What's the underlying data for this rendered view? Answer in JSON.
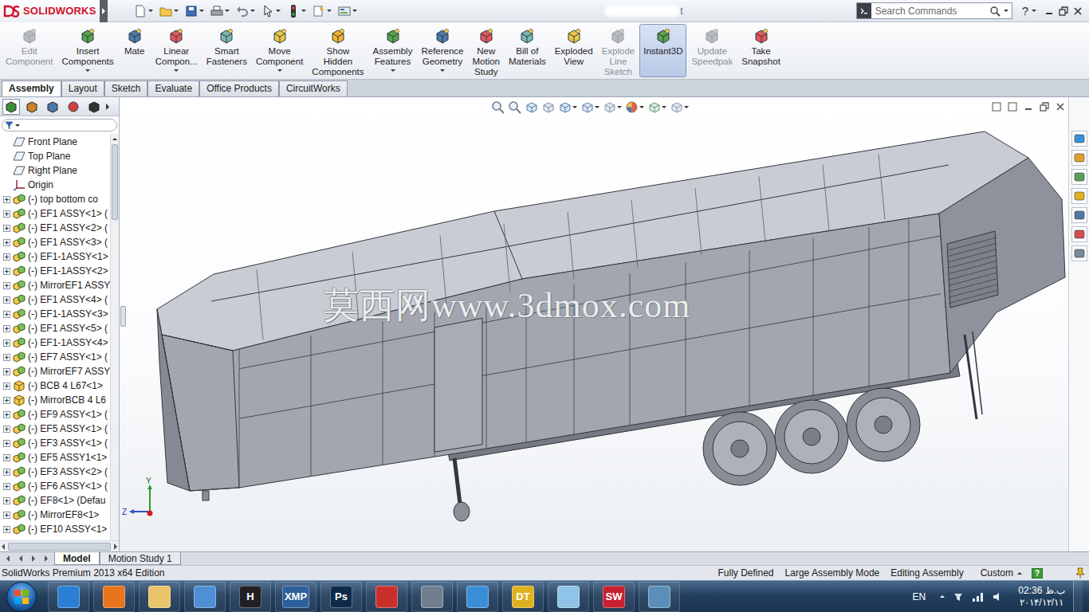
{
  "window": {
    "app": "SOLIDWORKS",
    "title": "t",
    "search": {
      "placeholder": "Search Commands"
    },
    "help": "?"
  },
  "ribbon": {
    "buttons": [
      {
        "lines": [
          "Edit",
          "Component"
        ],
        "disabled": true,
        "dropdown": false,
        "selected": false
      },
      {
        "lines": [
          "Insert",
          "Components"
        ],
        "disabled": false,
        "dropdown": true,
        "selected": false
      },
      {
        "lines": [
          "Mate"
        ],
        "disabled": false,
        "dropdown": false,
        "selected": false
      },
      {
        "lines": [
          "Linear",
          "Compon..."
        ],
        "disabled": false,
        "dropdown": true,
        "selected": false
      },
      {
        "lines": [
          "Smart",
          "Fasteners"
        ],
        "disabled": false,
        "dropdown": false,
        "selected": false
      },
      {
        "lines": [
          "Move",
          "Component"
        ],
        "disabled": false,
        "dropdown": true,
        "selected": false
      },
      {
        "lines": [
          "Show",
          "Hidden",
          "Components"
        ],
        "disabled": false,
        "dropdown": false,
        "selected": false
      },
      {
        "lines": [
          "Assembly",
          "Features"
        ],
        "disabled": false,
        "dropdown": true,
        "selected": false
      },
      {
        "lines": [
          "Reference",
          "Geometry"
        ],
        "disabled": false,
        "dropdown": true,
        "selected": false
      },
      {
        "lines": [
          "New",
          "Motion",
          "Study"
        ],
        "disabled": false,
        "dropdown": false,
        "selected": false
      },
      {
        "lines": [
          "Bill of",
          "Materials"
        ],
        "disabled": false,
        "dropdown": false,
        "selected": false
      },
      {
        "lines": [
          "Exploded",
          "View"
        ],
        "disabled": false,
        "dropdown": false,
        "selected": false
      },
      {
        "lines": [
          "Explode",
          "Line",
          "Sketch"
        ],
        "disabled": true,
        "dropdown": false,
        "selected": false
      },
      {
        "lines": [
          "Instant3D"
        ],
        "disabled": false,
        "dropdown": false,
        "selected": true
      },
      {
        "lines": [
          "Update",
          "Speedpak"
        ],
        "disabled": true,
        "dropdown": false,
        "selected": false
      },
      {
        "lines": [
          "Take",
          "Snapshot"
        ],
        "disabled": false,
        "dropdown": false,
        "selected": false
      }
    ]
  },
  "tabs": [
    {
      "label": "Assembly",
      "selected": true
    },
    {
      "label": "Layout",
      "selected": false
    },
    {
      "label": "Sketch",
      "selected": false
    },
    {
      "label": "Evaluate",
      "selected": false
    },
    {
      "label": "Office Products",
      "selected": false
    },
    {
      "label": "CircuitWorks",
      "selected": false
    }
  ],
  "tree": {
    "items": [
      {
        "label": "Front Plane",
        "kind": "plane",
        "expandable": false
      },
      {
        "label": "Top Plane",
        "kind": "plane",
        "expandable": false
      },
      {
        "label": "Right Plane",
        "kind": "plane",
        "expandable": false
      },
      {
        "label": "Origin",
        "kind": "origin",
        "expandable": false
      },
      {
        "label": "(-) top bottom co",
        "kind": "assembly",
        "expandable": true
      },
      {
        "label": "(-) EF1 ASSY<1> (",
        "kind": "assembly",
        "expandable": true
      },
      {
        "label": "(-) EF1 ASSY<2> (",
        "kind": "assembly",
        "expandable": true
      },
      {
        "label": "(-) EF1 ASSY<3> (",
        "kind": "assembly",
        "expandable": true
      },
      {
        "label": "(-) EF1-1ASSY<1>",
        "kind": "assembly",
        "expandable": true
      },
      {
        "label": "(-) EF1-1ASSY<2>",
        "kind": "assembly",
        "expandable": true
      },
      {
        "label": "(-) MirrorEF1 ASSY",
        "kind": "assembly",
        "expandable": true
      },
      {
        "label": "(-) EF1 ASSY<4> (",
        "kind": "assembly",
        "expandable": true
      },
      {
        "label": "(-) EF1-1ASSY<3>",
        "kind": "assembly",
        "expandable": true
      },
      {
        "label": "(-) EF1 ASSY<5> (",
        "kind": "assembly",
        "expandable": true
      },
      {
        "label": "(-) EF1-1ASSY<4>",
        "kind": "assembly",
        "expandable": true
      },
      {
        "label": "(-) EF7 ASSY<1> (",
        "kind": "assembly",
        "expandable": true
      },
      {
        "label": "(-) MirrorEF7 ASSY",
        "kind": "assembly",
        "expandable": true
      },
      {
        "label": "(-) BCB 4 L67<1>",
        "kind": "part",
        "expandable": true
      },
      {
        "label": "(-) MirrorBCB 4 L6",
        "kind": "part",
        "expandable": true
      },
      {
        "label": "(-) EF9 ASSY<1> (",
        "kind": "assembly",
        "expandable": true
      },
      {
        "label": "(-) EF5 ASSY<1> (",
        "kind": "assembly",
        "expandable": true
      },
      {
        "label": "(-) EF3 ASSY<1> (",
        "kind": "assembly",
        "expandable": true
      },
      {
        "label": "(-) EF5 ASSY1<1>",
        "kind": "assembly",
        "expandable": true
      },
      {
        "label": "(-) EF3 ASSY<2> (",
        "kind": "assembly",
        "expandable": true
      },
      {
        "label": "(-) EF6 ASSY<1> (",
        "kind": "assembly",
        "expandable": true
      },
      {
        "label": "(-) EF8<1> (Defau",
        "kind": "assembly",
        "expandable": true
      },
      {
        "label": "(-) MirrorEF8<1>",
        "kind": "assembly",
        "expandable": true
      },
      {
        "label": "(-) EF10 ASSY<1>",
        "kind": "assembly",
        "expandable": true
      }
    ]
  },
  "canvas": {
    "watermark": "莫西网www.3dmox.com",
    "triad": {
      "y": "Y",
      "z": "Z"
    }
  },
  "bottom_tabs": [
    {
      "label": "Model",
      "selected": true
    },
    {
      "label": "Motion Study 1",
      "selected": false
    }
  ],
  "status_bar": {
    "edition": "SolidWorks Premium 2013 x64 Edition",
    "items": [
      "Fully Defined",
      "Large Assembly Mode",
      "Editing Assembly"
    ],
    "units": "Custom",
    "help": "?"
  },
  "taskbar": {
    "apps": [
      {
        "color": "#2a7fd4"
      },
      {
        "color": "#e8741c"
      },
      {
        "color": "#e9c46a"
      },
      {
        "color": "#4f8fd6"
      },
      {
        "label": "H",
        "color": "#1f1f24"
      },
      {
        "label": "XMP",
        "color": "#2d5f9a"
      },
      {
        "label": "Ps",
        "color": "#0d2a4a"
      },
      {
        "color": "#c9302c"
      },
      {
        "color": "#6f7f8f"
      },
      {
        "color": "#3a8ed8"
      },
      {
        "label": "DT",
        "color": "#e0b020"
      },
      {
        "color": "#8fc3e8"
      },
      {
        "label": "SW",
        "color": "#c8202f"
      },
      {
        "color": "#5b8fb9"
      }
    ],
    "language": "EN",
    "time": "02:36 ب.ظ",
    "date": "۲۰۱۴/۱۲/۱۱"
  }
}
